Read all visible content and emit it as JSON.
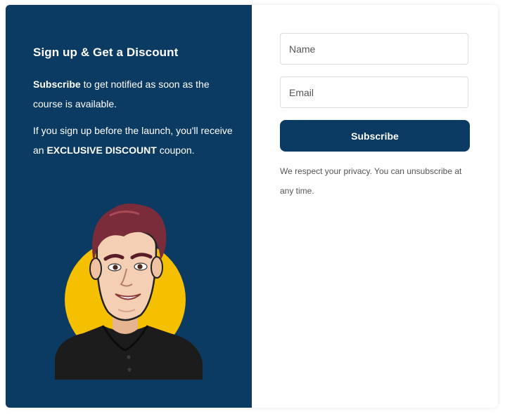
{
  "left_panel": {
    "title": "Sign up & Get a Discount",
    "para1_bold": "Subscribe",
    "para1_rest": " to get notified as soon as the course is available.",
    "para2_start": "If you sign up before the launch, you'll receive an ",
    "para2_bold": "EXCLUSIVE DISCOUNT",
    "para2_end": " coupon."
  },
  "form": {
    "name_placeholder": "Name",
    "email_placeholder": "Email",
    "subscribe_label": "Subscribe",
    "privacy_text": "We respect your privacy. You can unsubscribe at any time."
  },
  "colors": {
    "panel_navy": "#0b3a62",
    "accent_yellow": "#f5c000"
  },
  "icons": {
    "avatar": "cartoon-man-avatar"
  }
}
